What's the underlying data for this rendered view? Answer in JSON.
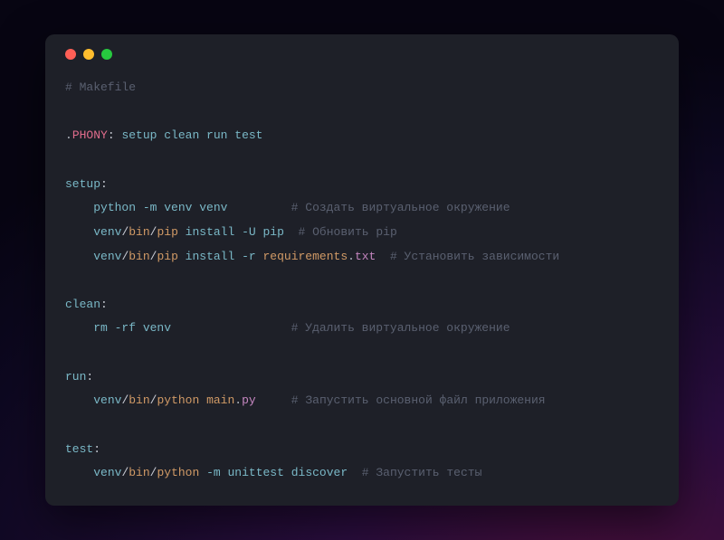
{
  "header_comment": "# Makefile",
  "phony": {
    "dot": ".",
    "keyword": "PHONY",
    "colon": ":",
    "targets": " setup clean run test"
  },
  "setup": {
    "name": "setup",
    "colon": ":",
    "l1": {
      "indent": "    ",
      "a": "python ",
      "b": "-m",
      "c": " venv venv",
      "pad": "         ",
      "comment": "# Создать виртуальное окружение"
    },
    "l2": {
      "indent": "    ",
      "a": "venv",
      "s1": "/",
      "b": "bin",
      "s2": "/",
      "c": "pip",
      "d": " install ",
      "e": "-U",
      "f": " pip",
      "pad": "  ",
      "comment": "# Обновить pip"
    },
    "l3": {
      "indent": "    ",
      "a": "venv",
      "s1": "/",
      "b": "bin",
      "s2": "/",
      "c": "pip",
      "d": " install ",
      "e": "-r",
      "f": " requirements",
      "g": ".",
      "h": "txt",
      "pad": "  ",
      "comment": "# Установить зависимости"
    }
  },
  "clean": {
    "name": "clean",
    "colon": ":",
    "l1": {
      "indent": "    ",
      "a": "rm ",
      "b": "-rf",
      "c": " venv",
      "pad": "                 ",
      "comment": "# Удалить виртуальное окружение"
    }
  },
  "run": {
    "name": "run",
    "colon": ":",
    "l1": {
      "indent": "    ",
      "a": "venv",
      "s1": "/",
      "b": "bin",
      "s2": "/",
      "c": "python",
      "d": " main",
      "e": ".",
      "f": "py",
      "pad": "     ",
      "comment": "# Запустить основной файл приложения"
    }
  },
  "test": {
    "name": "test",
    "colon": ":",
    "l1": {
      "indent": "    ",
      "a": "venv",
      "s1": "/",
      "b": "bin",
      "s2": "/",
      "c": "python",
      "d": " ",
      "e": "-m",
      "f": " unittest discover",
      "pad": "  ",
      "comment": "# Запустить тесты"
    }
  }
}
